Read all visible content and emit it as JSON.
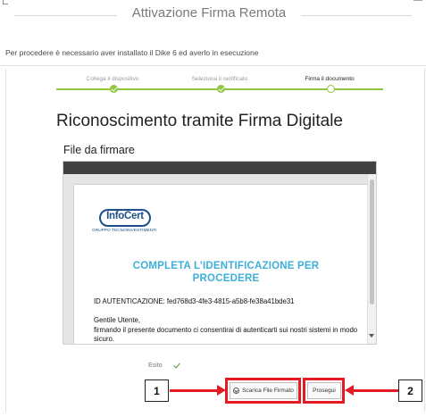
{
  "header": {
    "title": "Attivazione Firma Remota"
  },
  "notice": "Per procedere è necessario aver installato il Dike 6 ed averlo in esecuzione",
  "steps": [
    {
      "label": "Collega il dispositivo",
      "state": "done"
    },
    {
      "label": "Seleziona il certificato",
      "state": "done"
    },
    {
      "label": "Firma il documento",
      "state": "current"
    }
  ],
  "main": {
    "title": "Riconoscimento tramite Firma Digitale",
    "file_label": "File da firmare"
  },
  "document": {
    "logo": "InfoCert",
    "logo_sub": "GRUPPO TECNOINVESTIMENTI",
    "headline_1": "COMPLETA L’IDENTIFICAZIONE PER",
    "headline_2": "PROCEDERE",
    "auth_id": "ID AUTENTICAZIONE: fed768d3-4fe3-4815-a5b8-fe38a41bde31",
    "greeting": "Gentile Utente,",
    "body": "firmando il presente documento ci consentirai di autenticarti sui nostri sistemi in modo sicuro."
  },
  "result": {
    "label": "Esito"
  },
  "buttons": {
    "download": "Scarica File Firmato",
    "proceed": "Prosegui"
  },
  "callouts": {
    "one": "1",
    "two": "2"
  },
  "colors": {
    "accent_green": "#8ec63f",
    "doc_headline": "#3dafd9",
    "logo_blue": "#1d4f8a",
    "highlight_red": "#e31b23"
  }
}
